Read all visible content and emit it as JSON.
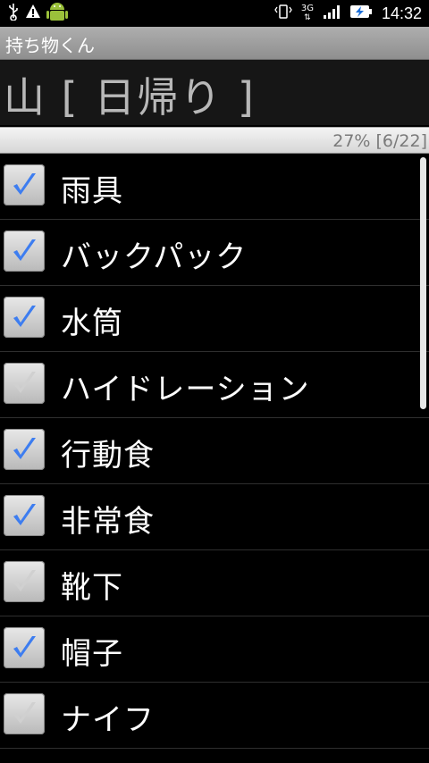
{
  "status_bar": {
    "time": "14:32",
    "network": "3G"
  },
  "app": {
    "title": "持ち物くん"
  },
  "list_header": {
    "title": "山 [ 日帰り ]"
  },
  "progress": {
    "text": "27% [6/22]",
    "percent": 27
  },
  "items": [
    {
      "label": "雨具",
      "checked": true
    },
    {
      "label": "バックパック",
      "checked": true
    },
    {
      "label": "水筒",
      "checked": true
    },
    {
      "label": "ハイドレーション",
      "checked": false
    },
    {
      "label": "行動食",
      "checked": true
    },
    {
      "label": "非常食",
      "checked": true
    },
    {
      "label": "靴下",
      "checked": false
    },
    {
      "label": "帽子",
      "checked": true
    },
    {
      "label": "ナイフ",
      "checked": false
    }
  ],
  "colors": {
    "check_blue": "#3d7df0",
    "check_gray": "#d0d0d0"
  }
}
